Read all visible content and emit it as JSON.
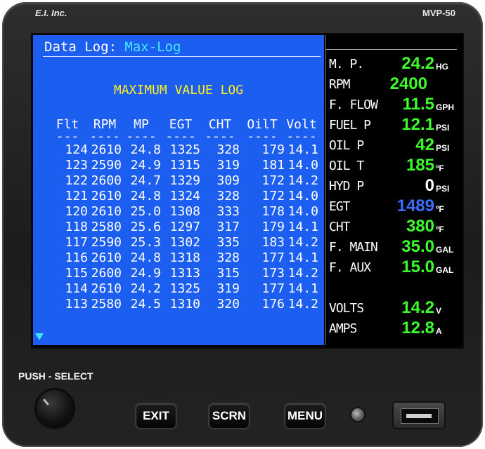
{
  "device": {
    "brand": "E.I. Inc.",
    "model": "MVP-50"
  },
  "log": {
    "header_label": "Data Log:",
    "header_mode": "Max-Log",
    "title": "MAXIMUM VALUE LOG",
    "columns": [
      "Flt",
      "RPM",
      "MP",
      "EGT",
      "CHT",
      "OilT",
      "Volt"
    ],
    "rows": [
      [
        "124",
        "2610",
        "24.8",
        "1325",
        "328",
        "179",
        "14.1"
      ],
      [
        "123",
        "2590",
        "24.9",
        "1315",
        "319",
        "181",
        "14.0"
      ],
      [
        "122",
        "2600",
        "24.7",
        "1329",
        "309",
        "172",
        "14.2"
      ],
      [
        "121",
        "2610",
        "24.8",
        "1324",
        "328",
        "172",
        "14.0"
      ],
      [
        "120",
        "2610",
        "25.0",
        "1308",
        "333",
        "178",
        "14.0"
      ],
      [
        "118",
        "2580",
        "25.6",
        "1297",
        "317",
        "179",
        "14.1"
      ],
      [
        "117",
        "2590",
        "25.3",
        "1302",
        "335",
        "183",
        "14.2"
      ],
      [
        "116",
        "2610",
        "24.8",
        "1318",
        "328",
        "177",
        "14.1"
      ],
      [
        "115",
        "2600",
        "24.9",
        "1313",
        "315",
        "173",
        "14.2"
      ],
      [
        "114",
        "2610",
        "24.2",
        "1325",
        "319",
        "177",
        "14.1"
      ],
      [
        "113",
        "2580",
        "24.5",
        "1310",
        "320",
        "176",
        "14.2"
      ]
    ]
  },
  "gauges": [
    {
      "label": "M. P.",
      "value": "24.2",
      "unit": "HG",
      "color": "#3cff2a"
    },
    {
      "label": "RPM",
      "value": "2400",
      "unit": "",
      "color": "#3cff2a"
    },
    {
      "label": "F. FLOW",
      "value": "11.5",
      "unit": "GPH",
      "color": "#3cff2a"
    },
    {
      "label": "FUEL P",
      "value": "12.1",
      "unit": "PSI",
      "color": "#3cff2a"
    },
    {
      "label": "OIL P",
      "value": "42",
      "unit": "PSI",
      "color": "#3cff2a"
    },
    {
      "label": "OIL T",
      "value": "185",
      "unit": "ºF",
      "color": "#3cff2a"
    },
    {
      "label": "HYD P",
      "value": "0",
      "unit": "PSI",
      "color": "#ffffff"
    },
    {
      "label": "EGT",
      "value": "1489",
      "unit": "ºF",
      "color": "#3a6cff"
    },
    {
      "label": "CHT",
      "value": "380",
      "unit": "ºF",
      "color": "#3cff2a"
    },
    {
      "label": "F. MAIN",
      "value": "35.0",
      "unit": "GAL",
      "color": "#3cff2a"
    },
    {
      "label": "F. AUX",
      "value": "15.0",
      "unit": "GAL",
      "color": "#3cff2a"
    },
    {
      "label": "VOLTS",
      "value": "14.2",
      "unit": "V",
      "color": "#3cff2a"
    },
    {
      "label": "AMPS",
      "value": "12.8",
      "unit": "A",
      "color": "#3cff2a"
    }
  ],
  "controls": {
    "knob_label": "PUSH - SELECT",
    "exit": "EXIT",
    "screen": "SCRN",
    "menu": "MENU"
  }
}
